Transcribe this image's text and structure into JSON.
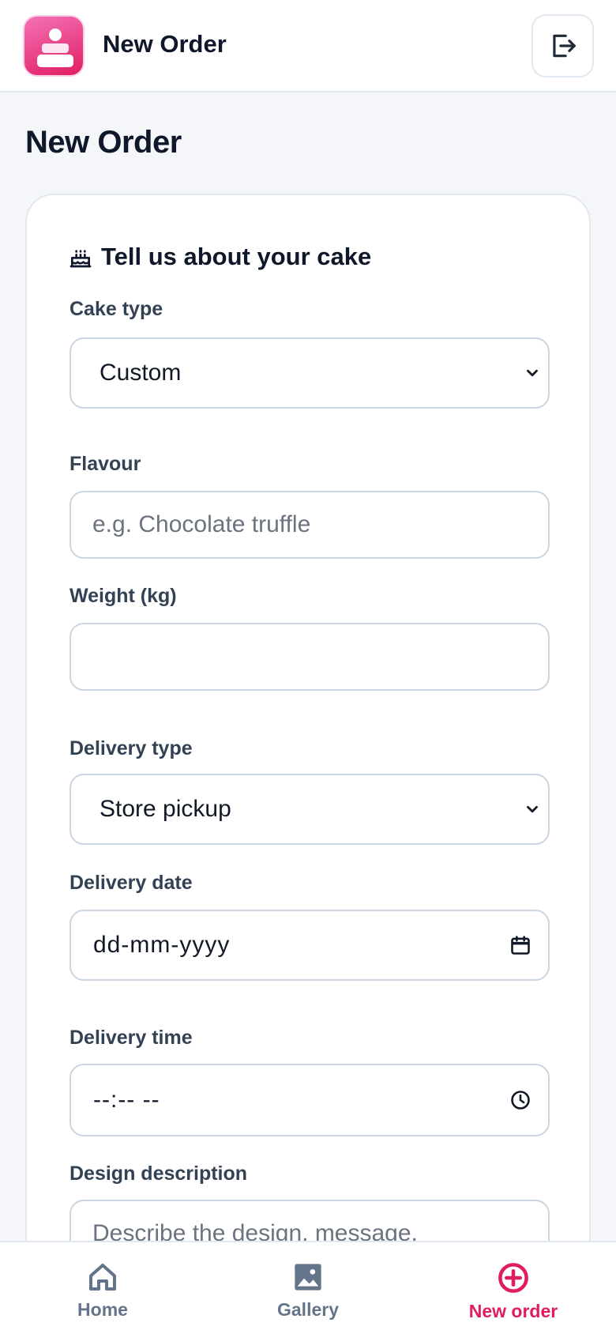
{
  "header": {
    "title": "New Order"
  },
  "page": {
    "title": "New Order"
  },
  "form": {
    "section_title": "Tell us about your cake",
    "cake_type": {
      "label": "Cake type",
      "value": "Custom"
    },
    "flavour": {
      "label": "Flavour",
      "placeholder": "e.g. Chocolate truffle",
      "value": ""
    },
    "weight": {
      "label": "Weight (kg)",
      "value": ""
    },
    "delivery_type": {
      "label": "Delivery type",
      "value": "Store pickup"
    },
    "delivery_date": {
      "label": "Delivery date",
      "placeholder": "dd-mm-yyyy"
    },
    "delivery_time": {
      "label": "Delivery time",
      "placeholder": "--:-- --"
    },
    "design_description": {
      "label": "Design description",
      "placeholder": "Describe the design, message,"
    }
  },
  "bottom_nav": {
    "items": [
      {
        "label": "Home",
        "icon": "home-icon",
        "active": false
      },
      {
        "label": "Gallery",
        "icon": "gallery-icon",
        "active": false
      },
      {
        "label": "New order",
        "icon": "plus-circle-icon",
        "active": true
      }
    ]
  },
  "colors": {
    "accent": "#e11d62",
    "text": "#0f172a",
    "muted": "#64748b",
    "border": "#cbd5e1",
    "background": "#f4f6f9"
  }
}
